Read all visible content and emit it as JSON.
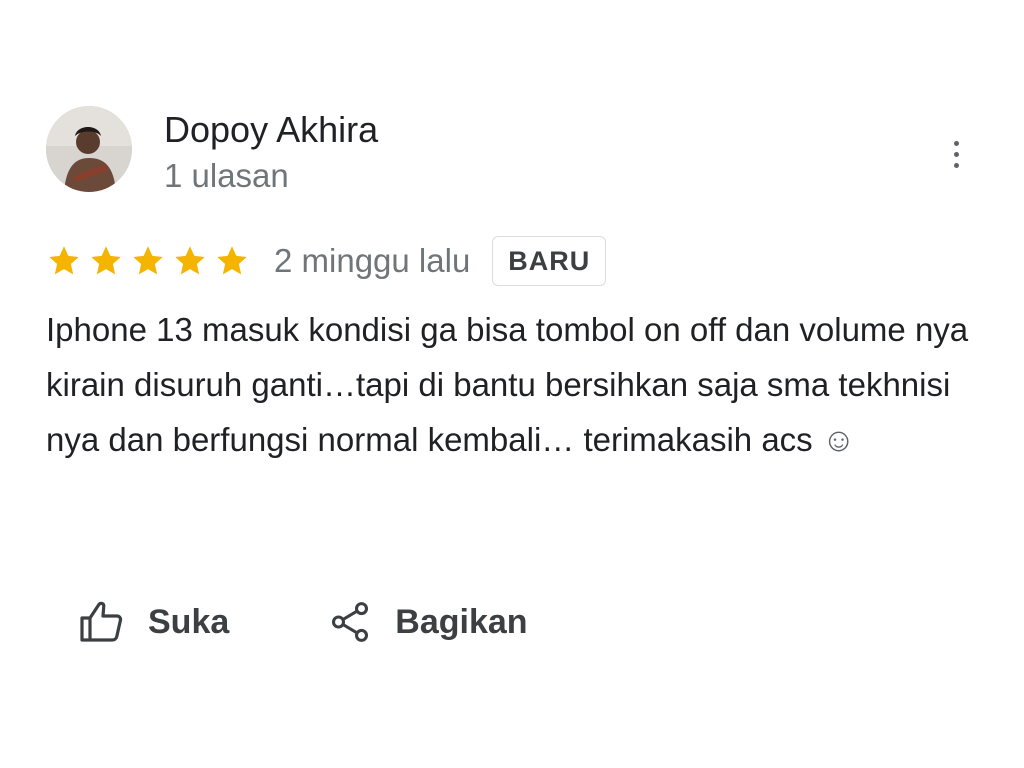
{
  "reviewer": {
    "name": "Dopoy Akhira",
    "review_count": "1 ulasan",
    "avatar_icon": "avatar-photo"
  },
  "menu": {
    "icon": "more-vert-icon"
  },
  "rating": {
    "stars": 5,
    "max": 5,
    "star_color": "#f4b400",
    "time": "2 minggu lalu",
    "badge": "BARU"
  },
  "review": {
    "text": "Iphone 13 masuk kondisi ga bisa tombol on off dan volume nya kirain disuruh ganti…tapi di bantu bersihkan saja sma tekhnisi nya dan berfungsi normal kembali… terimakasih acs",
    "emoji": "☺"
  },
  "actions": {
    "like_label": "Suka",
    "like_icon": "thumbs-up-icon",
    "share_label": "Bagikan",
    "share_icon": "share-icon"
  }
}
